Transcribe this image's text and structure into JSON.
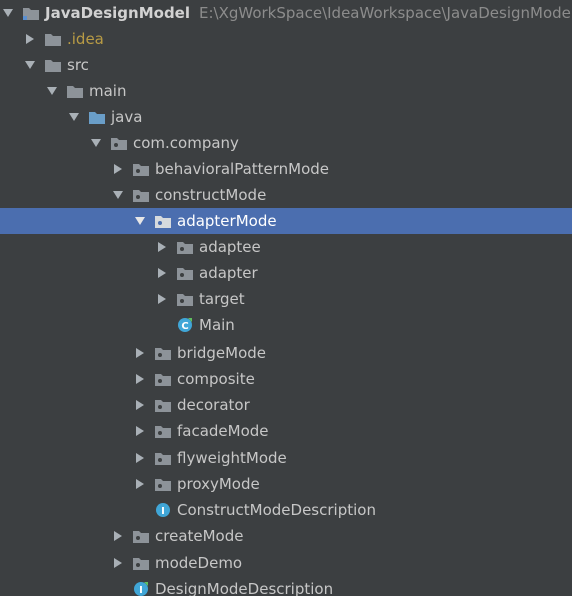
{
  "colors": {
    "background": "#3c3f41",
    "selection": "#4b6eaf",
    "text": "#c7c7c7",
    "excluded_text": "#b89b45",
    "path_text": "#8c8c8c",
    "folder": "#8d9399",
    "source_folder": "#6a9ec8",
    "class_icon": "#40a6d7"
  },
  "project": {
    "name": "JavaDesignModel",
    "path": "E:\\XgWorkSpace\\IdeaWorkspace\\JavaDesignMode"
  },
  "nodes": {
    "idea": {
      "label": ".idea",
      "icon": "folder-icon"
    },
    "src": {
      "label": "src",
      "icon": "folder-icon"
    },
    "main": {
      "label": "main",
      "icon": "folder-icon"
    },
    "java": {
      "label": "java",
      "icon": "source-folder-icon"
    },
    "com_company": {
      "label": "com.company",
      "icon": "package-icon"
    },
    "behavioral": {
      "label": "behavioralPatternMode",
      "icon": "package-icon"
    },
    "construct": {
      "label": "constructMode",
      "icon": "package-icon"
    },
    "adapterMode": {
      "label": "adapterMode",
      "icon": "package-icon"
    },
    "adaptee": {
      "label": "adaptee",
      "icon": "package-icon"
    },
    "adapter": {
      "label": "adapter",
      "icon": "package-icon"
    },
    "target": {
      "label": "target",
      "icon": "package-icon"
    },
    "main_class": {
      "label": "Main",
      "icon": "class-icon"
    },
    "bridge": {
      "label": "bridgeMode",
      "icon": "package-icon"
    },
    "composite": {
      "label": "composite",
      "icon": "package-icon"
    },
    "decorator": {
      "label": "decorator",
      "icon": "package-icon"
    },
    "facade": {
      "label": "facadeMode",
      "icon": "package-icon"
    },
    "flyweight": {
      "label": "flyweightMode",
      "icon": "package-icon"
    },
    "proxy": {
      "label": "proxyMode",
      "icon": "package-icon"
    },
    "construct_desc": {
      "label": "ConstructModeDescription",
      "icon": "interface-icon"
    },
    "create": {
      "label": "createMode",
      "icon": "package-icon"
    },
    "modeDemo": {
      "label": "modeDemo",
      "icon": "package-icon"
    },
    "design_desc": {
      "label": "DesignModeDescription",
      "icon": "interface-icon"
    }
  }
}
